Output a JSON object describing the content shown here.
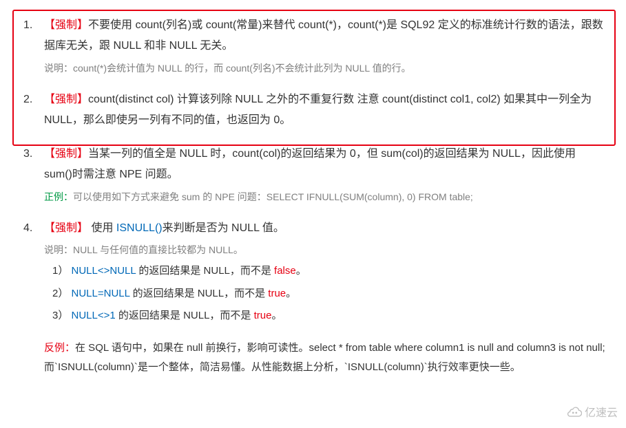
{
  "items": [
    {
      "tag": "【强制】",
      "body_parts": [
        "不要使用 count(列名)或 count(常量)来替代 count(*)，count(*)是 SQL92 定义的标准统计行数的语法，跟数据库无关，跟 NULL 和非 NULL 无关。"
      ],
      "note_label": "说明：",
      "note": "count(*)会统计值为 NULL 的行，而 count(列名)不会统计此列为 NULL 值的行。"
    },
    {
      "tag": "【强制】",
      "body_parts": [
        "count(distinct col)  计算该列除 NULL 之外的不重复行数  注意  count(distinct col1, col2)  如果其中一列全为 NULL，那么即使另一列有不同的值，也返回为 0。"
      ]
    },
    {
      "tag": "【强制】",
      "body_parts": [
        "当某一列的值全是 NULL 时，count(col)的返回结果为 0，但 sum(col)的返回结果为 NULL，因此使用 sum()时需注意 NPE 问题。"
      ],
      "good_label": "正例：",
      "good": "可以使用如下方式来避免 sum 的 NPE 问题：SELECT IFNULL(SUM(column), 0) FROM table;"
    },
    {
      "tag": "【强制】",
      "body_pre": " 使用 ",
      "body_blue": "ISNULL()",
      "body_post": "来判断是否为 NULL 值。",
      "note_label": "说明：",
      "note": "NULL 与任何值的直接比较都为 NULL。",
      "subs": [
        {
          "n": "1）",
          "code": "NULL<>NULL",
          "mid": " 的返回结果是 NULL，而不是 ",
          "kw": "false",
          "suffix": "。"
        },
        {
          "n": "2）",
          "code": "NULL=NULL",
          "mid": " 的返回结果是 NULL，而不是 ",
          "kw": "true",
          "suffix": "。"
        },
        {
          "n": "3）",
          "code": "NULL<>1",
          "mid": " 的返回结果是 NULL，而不是 ",
          "kw": "true",
          "suffix": "。"
        }
      ]
    }
  ],
  "bad_example": {
    "label": "反例：",
    "text": "在 SQL 语句中，如果在 null 前换行，影响可读性。select * from table where column1 is null and column3 is not null;  而`ISNULL(column)`是一个整体，简洁易懂。从性能数据上分析，`ISNULL(column)`执行效率更快一些。"
  },
  "watermark": "亿速云"
}
